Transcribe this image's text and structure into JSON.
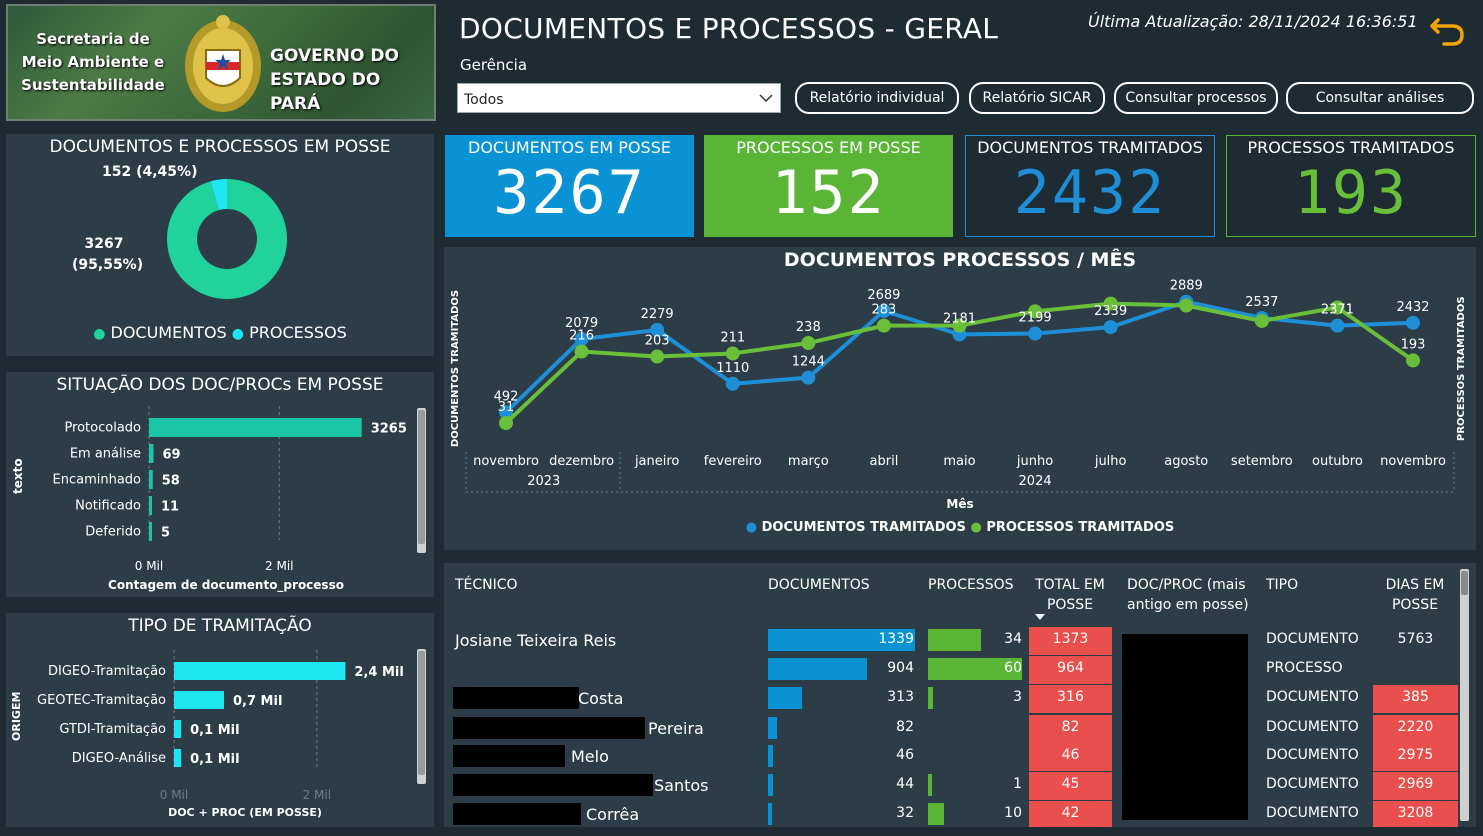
{
  "header": {
    "logo_left_lines": [
      "Secretaria de",
      "Meio Ambiente e",
      "Sustentabilidade"
    ],
    "logo_right_lines": [
      "GOVERNO DO",
      "ESTADO DO PARÁ"
    ],
    "title": "DOCUMENTOS E PROCESSOS - GERAL",
    "last_update": "Última Atualização: 28/11/2024 16:36:51",
    "gerencia_label": "Gerência",
    "gerencia_value": "Todos",
    "buttons": [
      "Relatório individual",
      "Relatório SICAR",
      "Consultar processos",
      "Consultar análises"
    ],
    "back_icon": "undo-arrow-icon",
    "accent": "#f0a500"
  },
  "donut": {
    "title": "DOCUMENTOS E PROCESSOS EM POSSE",
    "slices": [
      {
        "name": "DOCUMENTOS",
        "value": 3267,
        "label": "3267",
        "pct": "(95,55%)",
        "color": "#1fd39b"
      },
      {
        "name": "PROCESSOS",
        "value": 152,
        "label": "152 (4,45%)",
        "color": "#1ee6f0"
      }
    ]
  },
  "situacao": {
    "title": "SITUAÇÃO DOS DOC/PROCs EM POSSE",
    "ylabel": "texto",
    "xlabel": "Contagem de documento_processo",
    "ticks": [
      "0 Mil",
      "2 Mil"
    ],
    "tick_values": [
      0,
      2000
    ],
    "xmax": 3300,
    "color": "#1cc4a8",
    "bars": [
      {
        "label": "Protocolado",
        "value": 3265
      },
      {
        "label": "Em análise",
        "value": 69
      },
      {
        "label": "Encaminhado",
        "value": 58
      },
      {
        "label": "Notificado",
        "value": 11
      },
      {
        "label": "Deferido",
        "value": 5
      }
    ]
  },
  "tramitacao": {
    "title": "TIPO DE TRAMITAÇÃO",
    "ylabel": "ORIGEM",
    "xlabel": "DOC + PROC (EM POSSE)",
    "ticks": [
      "0 Mil",
      "2 Mil"
    ],
    "tick_values": [
      0,
      2000
    ],
    "xmax": 2800,
    "color": "#1ee6f0",
    "bars": [
      {
        "label": "DIGEO-Tramitação",
        "value": 2400,
        "text": "2,4 Mil"
      },
      {
        "label": "GEOTEC-Tramitação",
        "value": 700,
        "text": "0,7 Mil"
      },
      {
        "label": "GTDI-Tramitação",
        "value": 100,
        "text": "0,1 Mil"
      },
      {
        "label": "DIGEO-Análise",
        "value": 100,
        "text": "0,1 Mil"
      }
    ]
  },
  "kpis": [
    {
      "label": "DOCUMENTOS EM POSSE",
      "value": "3267",
      "bg": "#0a93d4",
      "fg": "#ffffff",
      "border": "#0a93d4"
    },
    {
      "label": "PROCESSOS EM POSSE",
      "value": "152",
      "bg": "#5ab536",
      "fg": "#ffffff",
      "border": "#5ab536"
    },
    {
      "label": "DOCUMENTOS TRAMITADOS",
      "value": "2432",
      "bg": "#1f2b33",
      "fg": "#1e8fd6",
      "border": "#1e8fd6"
    },
    {
      "label": "PROCESSOS TRAMITADOS",
      "value": "193",
      "bg": "#1f2b33",
      "fg": "#6abf3a",
      "border": "#5ab536"
    }
  ],
  "chart_data": {
    "type": "line",
    "title": "DOCUMENTOS PROCESSOS / MÊS",
    "xlabel": "Mês",
    "ylabel_left": "DOCUMENTOS TRAMITADOS",
    "ylabel_right": "PROCESSOS TRAMITADOS",
    "categories": [
      "novembro",
      "dezembro",
      "janeiro",
      "fevereiro",
      "março",
      "abril",
      "maio",
      "junho",
      "julho",
      "agosto",
      "setembro",
      "outubro",
      "novembro"
    ],
    "year_labels": [
      {
        "text": "2023",
        "index": 0.5
      },
      {
        "text": "2024",
        "index": 7
      }
    ],
    "series": [
      {
        "name": "DOCUMENTOS TRAMITADOS",
        "color": "#1e8fd6",
        "values": [
          492,
          2079,
          2279,
          1110,
          1244,
          2689,
          2181,
          2199,
          2339,
          2889,
          2537,
          2371,
          2432
        ]
      },
      {
        "name": "PROCESSOS TRAMITADOS",
        "color": "#6abf3a",
        "values": [
          31,
          216,
          203,
          211,
          238,
          283,
          283,
          320,
          340,
          335,
          295,
          330,
          193
        ]
      }
    ],
    "labels_docs": [
      "492",
      "2079",
      "2279",
      "1110",
      "1244",
      "2689",
      "2181",
      "2199",
      "2339",
      "2889",
      "2537",
      "2371",
      "2432"
    ],
    "labels_procs": [
      "31",
      "216",
      "203",
      "211",
      "238",
      "283",
      "",
      "",
      "",
      "",
      "",
      "",
      "193"
    ],
    "docs_range": [
      0,
      3100
    ],
    "procs_range": [
      0,
      370
    ],
    "legend": "bottom"
  },
  "table": {
    "headers": [
      "TÉCNICO",
      "DOCUMENTOS",
      "PROCESSOS",
      "TOTAL EM POSSE",
      "DOC/PROC (mais antigo em posse)",
      "TIPO",
      "DIAS EM POSSE"
    ],
    "sort_icon": "sort-desc-icon",
    "doc_color": "#0a93d4",
    "proc_color": "#5ab536",
    "red": "#e9504d",
    "docs_max": 1339,
    "procs_max": 60,
    "rows": [
      {
        "name": "Josiane Teixeira Reis",
        "docs": 1339,
        "procs": 34,
        "total": "1373",
        "tipo": "DOCUMENTO",
        "dias": "5763",
        "dias_red": false
      },
      {
        "name": "",
        "docs": 904,
        "procs": 60,
        "total": "964",
        "tipo": "PROCESSO",
        "dias": "",
        "dias_red": false
      },
      {
        "name": "Costa",
        "docs": 313,
        "procs": 3,
        "total": "316",
        "tipo": "DOCUMENTO",
        "dias": "385",
        "dias_red": true
      },
      {
        "name": "Pereira",
        "docs": 82,
        "procs": 0,
        "total": "82",
        "tipo": "DOCUMENTO",
        "dias": "2220",
        "dias_red": true
      },
      {
        "name": "Melo",
        "docs": 46,
        "procs": 0,
        "total": "46",
        "tipo": "DOCUMENTO",
        "dias": "2975",
        "dias_red": true
      },
      {
        "name": "Santos",
        "docs": 44,
        "procs": 1,
        "total": "45",
        "tipo": "DOCUMENTO",
        "dias": "2969",
        "dias_red": true
      },
      {
        "name": "Corrêa",
        "docs": 32,
        "procs": 10,
        "total": "42",
        "tipo": "DOCUMENTO",
        "dias": "3208",
        "dias_red": true
      }
    ]
  }
}
